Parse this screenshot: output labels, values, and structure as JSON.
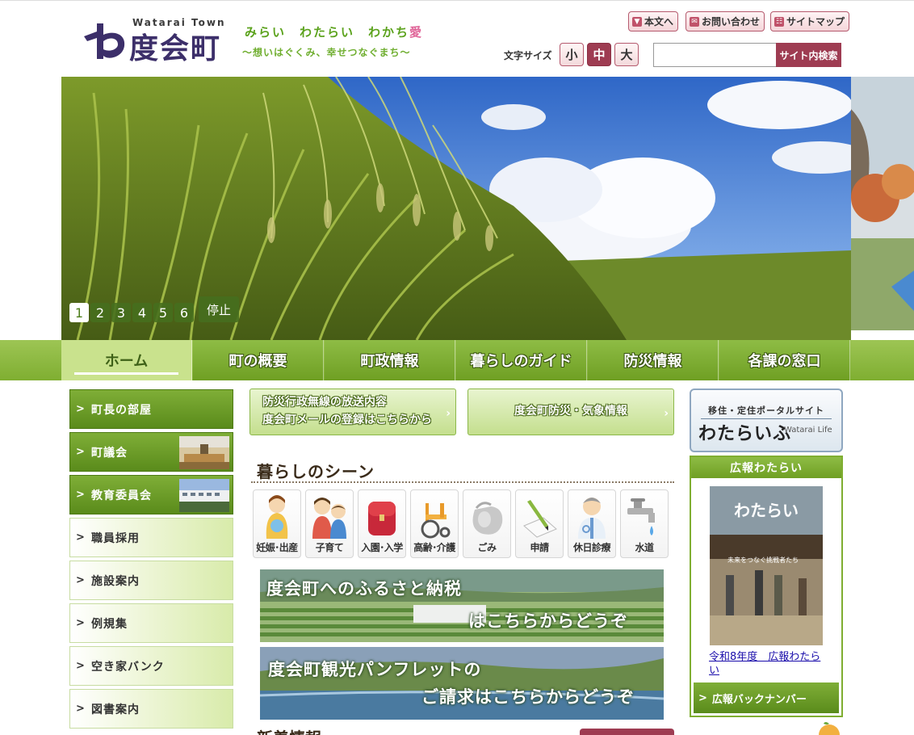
{
  "header": {
    "logo_en": "Watarai Town",
    "logo_jp": "度会町",
    "catch_main": "みらい　わたらい　わかち",
    "catch_ai": "愛",
    "catch_sub": "〜想いはぐくみ、幸せつなぐまち〜",
    "util": {
      "skip": "本文へ",
      "contact": "お問い合わせ",
      "sitemap": "サイトマップ"
    },
    "font_size": {
      "label": "文字サイズ",
      "small": "小",
      "medium": "中",
      "large": "大",
      "active": "medium"
    },
    "search": {
      "placeholder": "",
      "button": "サイト内検索"
    }
  },
  "slider": {
    "pages": [
      "1",
      "2",
      "3",
      "4",
      "5",
      "6"
    ],
    "active": "1",
    "stop": "停止"
  },
  "gnav": [
    "ホーム",
    "町の概要",
    "町政情報",
    "暮らしのガイド",
    "防災情報",
    "各課の窓口"
  ],
  "left_menu": [
    {
      "label": "町長の部屋",
      "style": "dark"
    },
    {
      "label": "町議会",
      "style": "dark"
    },
    {
      "label": "教育委員会",
      "style": "dark"
    },
    {
      "label": "職員採用",
      "style": "light"
    },
    {
      "label": "施設案内",
      "style": "light"
    },
    {
      "label": "例規集",
      "style": "light"
    },
    {
      "label": "空き家バンク",
      "style": "light"
    },
    {
      "label": "図書案内",
      "style": "light"
    }
  ],
  "center": {
    "banner1_line1": "防災行政無線の放送内容",
    "banner1_line2": "度会町メールの登録はこちらから",
    "banner2": "度会町防災・気象情報",
    "scene_title": "暮らしのシーン",
    "scenes": [
      "妊娠･出産",
      "子育て",
      "入園･入学",
      "高齢･介護",
      "ごみ",
      "申請",
      "休日診療",
      "水道"
    ],
    "furusato_line1": "度会町へのふるさと納税",
    "furusato_line2": "はこちらからどうぞ",
    "kanko_line1": "度会町観光パンフレットの",
    "kanko_line2": "ご請求はこちらからどうぞ",
    "news_title": "新着情報"
  },
  "right": {
    "portal_small": "移住・定住ポータルサイト",
    "portal_big": "わたらいふ",
    "portal_en": "Watarai Life",
    "koho_title": "広報わたらい",
    "koho_link": "令和8年度　広報わたらい",
    "koho_cover_title": "わたらい",
    "koho_cover_caption": "未来をつなぐ挑戦者たち",
    "koho_back": "広報バックナンバー"
  },
  "colors": {
    "brand_green": "#7fae31",
    "brand_purple": "#3c2f6a",
    "accent_red": "#9e3c52"
  }
}
